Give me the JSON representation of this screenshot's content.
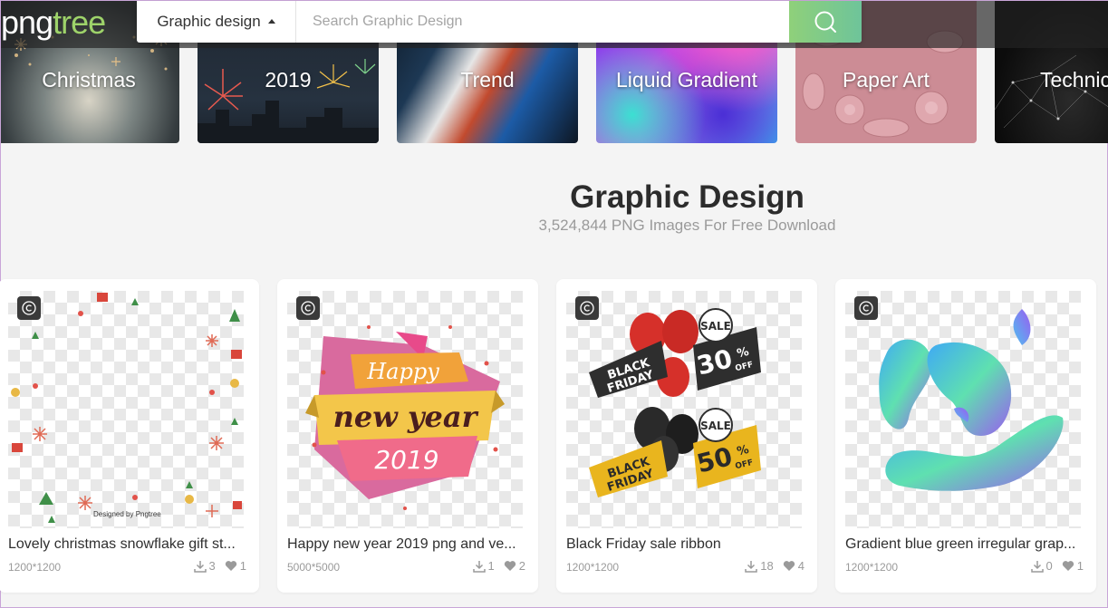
{
  "header": {
    "logo_part1": "png",
    "logo_part2": "tree",
    "category_select": "Graphic design",
    "search_placeholder": "Search Graphic Design",
    "search_icon": "search-icon"
  },
  "categories": [
    {
      "label": "Christmas"
    },
    {
      "label": "2019"
    },
    {
      "label": "Trend"
    },
    {
      "label": "Liquid Gradient"
    },
    {
      "label": "Paper Art"
    },
    {
      "label": "Technic"
    }
  ],
  "main": {
    "title": "Graphic Design",
    "subtitle": "3,524,844 PNG Images For Free Download"
  },
  "cards": [
    {
      "title": "Lovely christmas snowflake gift st...",
      "size": "1200*1200",
      "downloads": "3",
      "likes": "1",
      "signature": "Designed by Pngtree"
    },
    {
      "title": "Happy new year 2019 png and ve...",
      "size": "5000*5000",
      "downloads": "1",
      "likes": "2",
      "art_text": [
        "Happy",
        "new year",
        "2019"
      ]
    },
    {
      "title": "Black Friday sale ribbon",
      "size": "1200*1200",
      "downloads": "18",
      "likes": "4",
      "art_text": [
        "BLACK",
        "FRIDAY",
        "SALE",
        "30",
        "%",
        "OFF",
        "BLACK",
        "FRIDAY",
        "SALE",
        "50",
        "%",
        "OFF"
      ]
    },
    {
      "title": "Gradient blue green irregular grap...",
      "size": "1200*1200",
      "downloads": "0",
      "likes": "1"
    }
  ],
  "colors": {
    "brand_green": "#9ed36a",
    "search_button": "#7fcb8a",
    "page_bg": "#f4f4f4"
  }
}
